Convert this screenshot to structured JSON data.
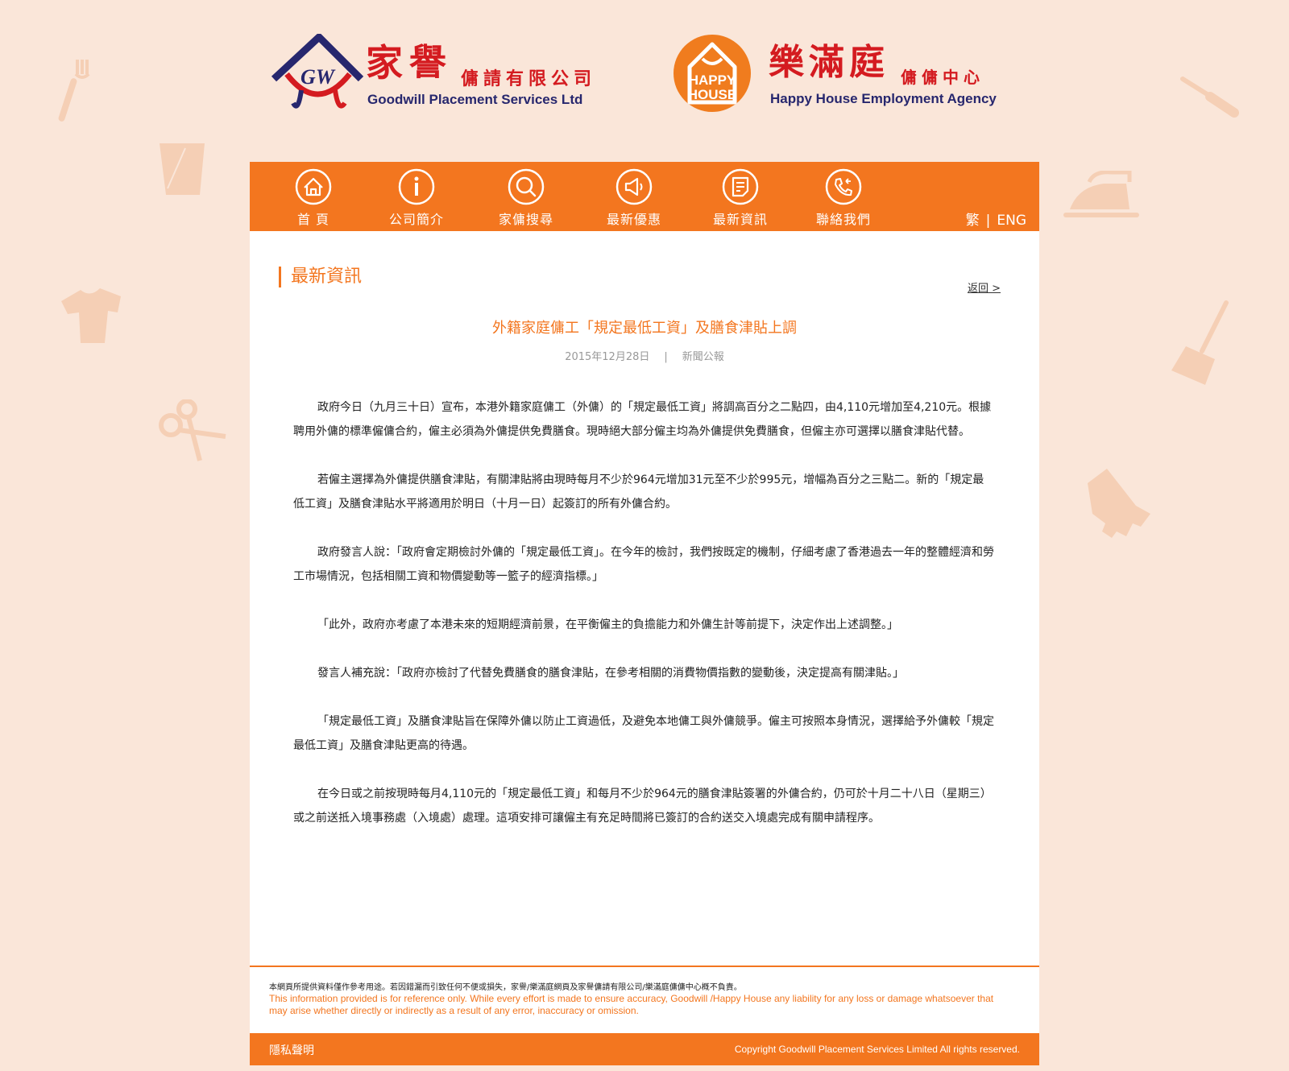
{
  "colors": {
    "accent": "#f3761f",
    "background": "#fae6d9",
    "logo_red": "#d41b20",
    "logo_navy": "#27276e"
  },
  "logos": {
    "goodwill": {
      "mark_text": "GW",
      "chinese_name_main": "家譽",
      "chinese_name_sub": "傭請有限公司",
      "english_name": "Goodwill Placement Services Ltd"
    },
    "happy_house": {
      "mark_line1": "HAPPY",
      "mark_line2": "HOUSE",
      "chinese_name_main": "樂滿庭",
      "chinese_name_sub": "傭傭中心",
      "english_name": "Happy House Employment Agency"
    }
  },
  "nav": {
    "items": [
      {
        "label": "首  頁",
        "icon": "home-icon"
      },
      {
        "label": "公司簡介",
        "icon": "info-icon"
      },
      {
        "label": "家傭搜尋",
        "icon": "search-icon"
      },
      {
        "label": "最新優惠",
        "icon": "megaphone-icon"
      },
      {
        "label": "最新資訊",
        "icon": "document-icon"
      },
      {
        "label": "聯絡我們",
        "icon": "phone-icon"
      }
    ],
    "lang_tc": "繁",
    "lang_sep": "|",
    "lang_en": "ENG"
  },
  "section": {
    "title": "最新資訊",
    "back": "返回 >"
  },
  "article": {
    "title": "外籍家庭傭工「規定最低工資」及膳食津貼上調",
    "date": "2015年12月28日",
    "meta_sep": "|",
    "category": "新聞公報",
    "paragraphs": [
      "政府今日（九月三十日）宣布，本港外籍家庭傭工（外傭）的「規定最低工資」將調高百分之二點四，由4,110元增加至4,210元。根據聘用外傭的標準僱傭合約，僱主必須為外傭提供免費膳食。現時絕大部分僱主均為外傭提供免費膳食，但僱主亦可選擇以膳食津貼代替。",
      "若僱主選擇為外傭提供膳食津貼，有關津貼將由現時每月不少於964元增加31元至不少於995元，增幅為百分之三點二。新的「規定最低工資」及膳食津貼水平將適用於明日（十月一日）起簽訂的所有外傭合約。",
      "政府發言人說：「政府會定期檢討外傭的「規定最低工資」。在今年的檢討，我們按既定的機制，仔細考慮了香港過去一年的整體經濟和勞工市場情況，包括相關工資和物價變動等一籃子的經濟指標。」",
      "「此外，政府亦考慮了本港未來的短期經濟前景，在平衡僱主的負擔能力和外傭生計等前提下，決定作出上述調整。」",
      "發言人補充說：「政府亦檢討了代替免費膳食的膳食津貼，在參考相關的消費物價指數的變動後，決定提高有關津貼。」",
      "「規定最低工資」及膳食津貼旨在保障外傭以防止工資過低，及避免本地傭工與外傭競爭。僱主可按照本身情況，選擇給予外傭較「規定最低工資」及膳食津貼更高的待遇。",
      "在今日或之前按現時每月4,110元的「規定最低工資」和每月不少於964元的膳食津貼簽署的外傭合約，仍可於十月二十八日（星期三）或之前送抵入境事務處（入境處）處理。這項安排可讓僱主有充足時間將已簽訂的合約送交入境處完成有關申請程序。"
    ]
  },
  "footer": {
    "disclaimer_cn": "本網頁所提供資料僅作參考用途。若因錯漏而引致任何不便或損失，家譽/樂滿庭網頁及家譽傭請有限公司/樂滿庭傭傭中心概不負責。",
    "disclaimer_en": "This information provided is for reference only. While every effort is made to ensure accuracy, Goodwill /Happy House any liability for any loss or damage whatsoever that may arise whether directly or indirectly as a result of any error, inaccuracy or omission.",
    "privacy": "隱私聲明",
    "copyright": "Copyright Goodwill Placement Services Limited All rights reserved."
  }
}
